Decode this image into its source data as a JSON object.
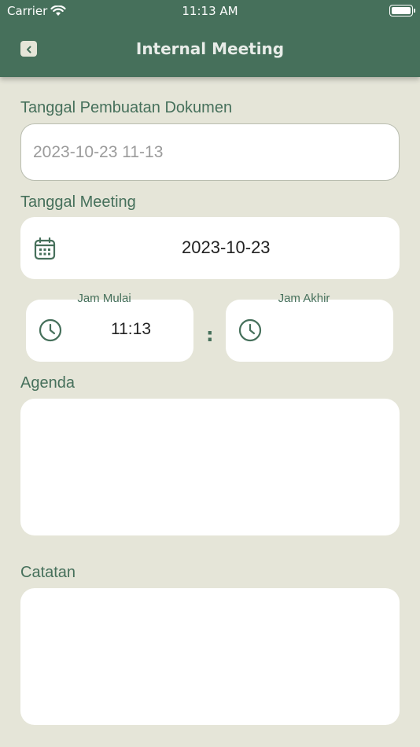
{
  "status_bar": {
    "carrier": "Carrier",
    "time": "11:13 AM"
  },
  "header": {
    "title": "Internal Meeting"
  },
  "doc_date": {
    "label": "Tanggal Pembuatan Dokumen",
    "placeholder": "2023-10-23 11-13"
  },
  "meeting_date": {
    "label": "Tanggal Meeting",
    "value": "2023-10-23"
  },
  "start_time": {
    "label": "Jam Mulai",
    "value": "11:13"
  },
  "separator": ":",
  "end_time": {
    "label": "Jam Akhir",
    "value": ""
  },
  "agenda": {
    "label": "Agenda",
    "value": ""
  },
  "notes": {
    "label": "Catatan",
    "value": ""
  },
  "colors": {
    "header": "#46705b",
    "background": "#e5e5d8",
    "accent": "#46705b"
  }
}
